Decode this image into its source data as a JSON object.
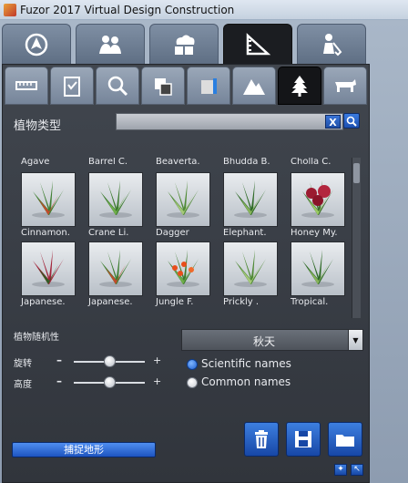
{
  "window": {
    "title": "Fuzor 2017 Virtual Design Construction"
  },
  "top_tabs": [
    {
      "icon": "navigation-icon",
      "active": false
    },
    {
      "icon": "people-icon",
      "active": false
    },
    {
      "icon": "cloud-server-icon",
      "active": false
    },
    {
      "icon": "measure-ruler-icon",
      "active": true
    },
    {
      "icon": "worker-cleaning-icon",
      "active": false
    }
  ],
  "sub_tabs": [
    {
      "icon": "ruler-icon",
      "active": false
    },
    {
      "icon": "clipboard-icon",
      "active": false
    },
    {
      "icon": "search-icon",
      "active": false
    },
    {
      "icon": "layers-icon",
      "active": false
    },
    {
      "icon": "box-icon",
      "active": false
    },
    {
      "icon": "terrain-icon",
      "active": false
    },
    {
      "icon": "tree-icon",
      "active": true
    },
    {
      "icon": "animal-icon",
      "active": false
    }
  ],
  "plant_panel": {
    "category_label": "植物类型",
    "search_value": "",
    "clear_label": "X"
  },
  "plants": [
    {
      "name": "Agave"
    },
    {
      "name": "Barrel C."
    },
    {
      "name": "Beaverta."
    },
    {
      "name": "Bhudda B."
    },
    {
      "name": "Cholla C."
    },
    {
      "name": "Cinnamon."
    },
    {
      "name": "Crane Li."
    },
    {
      "name": "Dagger"
    },
    {
      "name": "Elephant."
    },
    {
      "name": "Honey My."
    },
    {
      "name": "Japanese."
    },
    {
      "name": "Japanese."
    },
    {
      "name": "Jungle F."
    },
    {
      "name": "Prickly ."
    },
    {
      "name": "Tropical."
    }
  ],
  "controls": {
    "randomness_label": "植物随机性",
    "season_value": "秋天",
    "rotate_label": "旋转",
    "height_label": "高度",
    "minus": "–",
    "plus": "+",
    "rotate_level": 0.5,
    "height_level": 0.5,
    "scientific_names_label": "Scientific names",
    "common_names_label": "Common names",
    "names_mode": "scientific",
    "capture_terrain_label": "捕捉地形"
  },
  "colors": {
    "accent": "#1d54c0",
    "panel": "#3a3f47"
  }
}
